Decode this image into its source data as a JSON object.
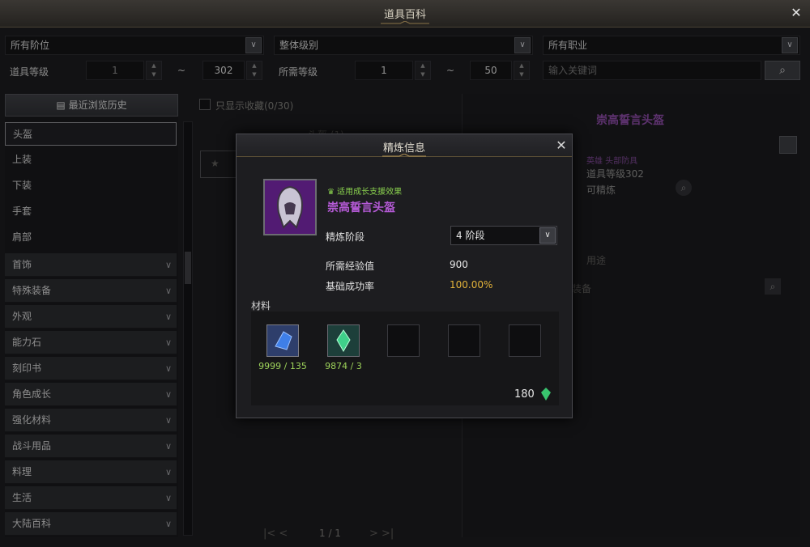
{
  "window": {
    "title": "道具百科",
    "close_icon": "close-icon"
  },
  "filters": {
    "tier": {
      "selected": "所有阶位"
    },
    "overall_level": {
      "selected": "整体级别"
    },
    "job": {
      "selected": "所有职业"
    },
    "item_level": {
      "label": "道具等级",
      "min": "1",
      "max": "302",
      "sep": "~"
    },
    "required_level": {
      "label": "所需等级",
      "min": "1",
      "max": "50",
      "sep": "~"
    },
    "search": {
      "placeholder": "输入关键词"
    }
  },
  "sidebar": {
    "history_label": "最近浏览历史",
    "items": [
      {
        "label": "头盔",
        "selected": true
      },
      {
        "label": "上装"
      },
      {
        "label": "下装"
      },
      {
        "label": "手套"
      },
      {
        "label": "肩部"
      }
    ],
    "categories": [
      "首饰",
      "特殊装备",
      "外观",
      "能力石",
      "刻印书",
      "角色成长",
      "强化材料",
      "战斗用品",
      "料理",
      "生活",
      "大陆百科"
    ]
  },
  "middle": {
    "favorites_label": "只显示收藏(0/30)",
    "group_header": "头盔 (1)",
    "pagination": "1 / 1"
  },
  "right": {
    "item_name": "崇高誓言头盔",
    "grade_type": "英雄 头部防具",
    "item_level": "道具等级302",
    "refinable": "可精炼",
    "tab_usage": "用途",
    "list_text": "装备"
  },
  "modal": {
    "title": "精炼信息",
    "growth_tag": "适用成长支援效果",
    "item_name": "崇高誓言头盔",
    "stage_label": "精炼阶段",
    "stage_value": "4 阶段",
    "exp_label": "所需经验值",
    "exp_value": "900",
    "rate_label": "基础成功率",
    "rate_value": "100.00%",
    "materials_label": "材料",
    "materials": [
      {
        "count": "9999 / 135"
      },
      {
        "count": "9874 / 3"
      }
    ],
    "cost": "180",
    "colors": {
      "name": "#b55ad6",
      "rate": "#e2b23a",
      "count": "#9dd25a"
    }
  }
}
